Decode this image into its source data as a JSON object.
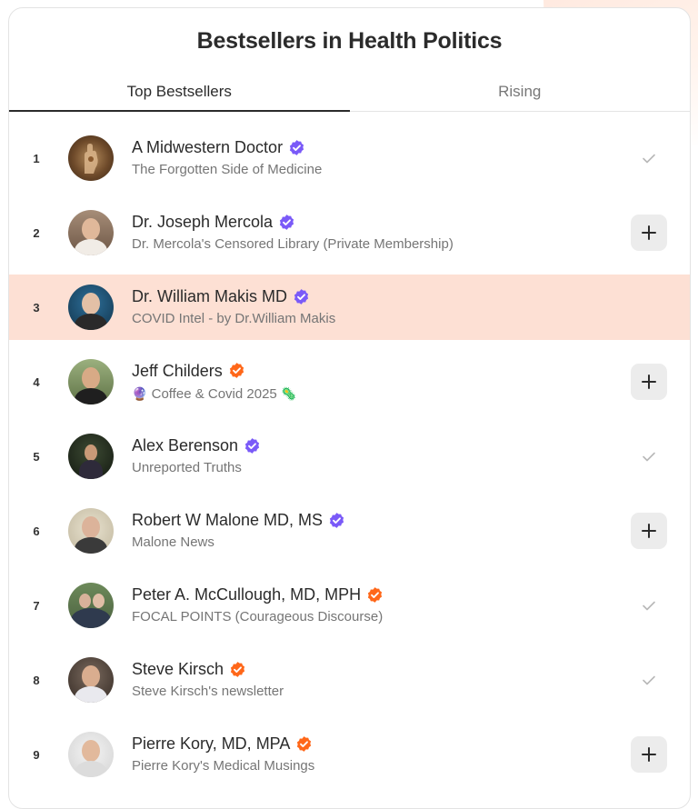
{
  "title": "Bestsellers in Health Politics",
  "tabs": [
    {
      "label": "Top Bestsellers",
      "active": true
    },
    {
      "label": "Rising",
      "active": false
    }
  ],
  "colors": {
    "badge_purple": "#7a5af8",
    "badge_orange": "#ff6719",
    "highlight": "#fde0d4"
  },
  "items": [
    {
      "rank": "1",
      "name": "A Midwestern Doctor",
      "publication": "The Forgotten Side of Medicine",
      "badge": "purple",
      "action": "check-icon"
    },
    {
      "rank": "2",
      "name": "Dr. Joseph Mercola",
      "publication": "Dr. Mercola's Censored Library (Private Membership)",
      "badge": "purple",
      "action": "plus-icon"
    },
    {
      "rank": "3",
      "name": "Dr. William Makis MD",
      "publication": "COVID Intel - by Dr.William Makis",
      "badge": "purple",
      "action": "none",
      "highlighted": true
    },
    {
      "rank": "4",
      "name": "Jeff Childers",
      "publication_prefix": "🔮",
      "publication": "Coffee & Covid 2025",
      "publication_suffix": "🦠",
      "badge": "orange",
      "action": "plus-icon"
    },
    {
      "rank": "5",
      "name": "Alex Berenson",
      "publication": "Unreported Truths",
      "badge": "purple",
      "action": "check-icon"
    },
    {
      "rank": "6",
      "name": "Robert W Malone MD, MS",
      "publication": "Malone News",
      "badge": "purple",
      "action": "plus-icon"
    },
    {
      "rank": "7",
      "name": "Peter A. McCullough, MD, MPH",
      "publication": "FOCAL POINTS (Courageous Discourse)",
      "badge": "orange",
      "action": "check-icon"
    },
    {
      "rank": "8",
      "name": "Steve Kirsch",
      "publication": "Steve Kirsch's newsletter",
      "badge": "orange",
      "action": "check-icon"
    },
    {
      "rank": "9",
      "name": "Pierre Kory, MD, MPA",
      "publication": "Pierre Kory's Medical Musings",
      "badge": "orange",
      "action": "plus-icon"
    }
  ]
}
